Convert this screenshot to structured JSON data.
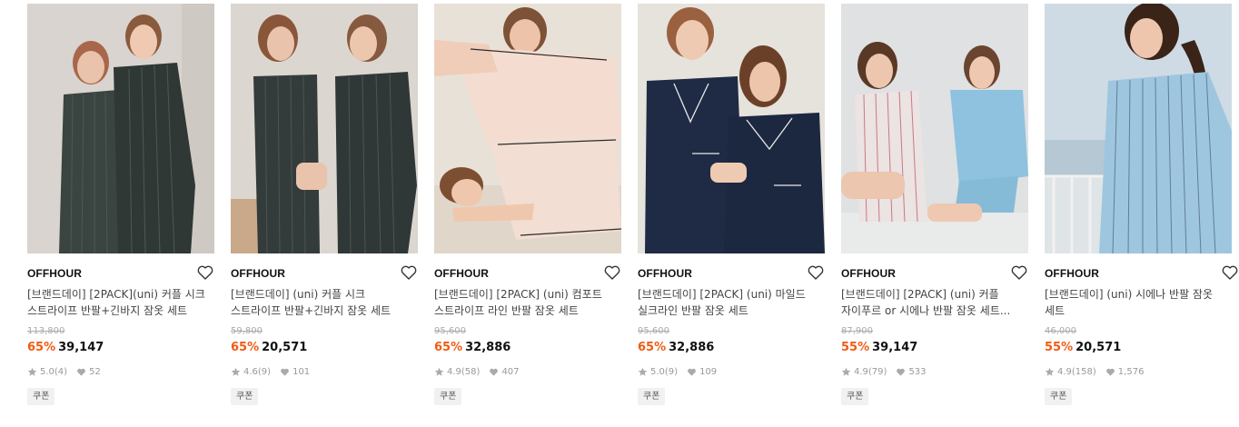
{
  "products": [
    {
      "brand": "OFFHOUR",
      "title": "[브랜드데이] [2PACK](uni) 커플 시크 스트라이프 반팔+긴바지 잠옷 세트",
      "original_price": "113,800",
      "discount": "65%",
      "price": "39,147",
      "rating": "5.0",
      "reviews": "(4)",
      "likes": "52",
      "coupon": "쿠폰"
    },
    {
      "brand": "OFFHOUR",
      "title": "[브랜드데이] (uni) 커플 시크 스트라이프 반팔+긴바지 잠옷 세트",
      "original_price": "59,800",
      "discount": "65%",
      "price": "20,571",
      "rating": "4.6",
      "reviews": "(9)",
      "likes": "101",
      "coupon": "쿠폰"
    },
    {
      "brand": "OFFHOUR",
      "title": "[브랜드데이] [2PACK] (uni) 컴포트 스트라이프 라인 반팔 잠옷 세트",
      "original_price": "95,600",
      "discount": "65%",
      "price": "32,886",
      "rating": "4.9",
      "reviews": "(58)",
      "likes": "407",
      "coupon": "쿠폰"
    },
    {
      "brand": "OFFHOUR",
      "title": "[브랜드데이] [2PACK] (uni) 마일드 실크라인 반팔 잠옷 세트",
      "original_price": "95,600",
      "discount": "65%",
      "price": "32,886",
      "rating": "5.0",
      "reviews": "(9)",
      "likes": "109",
      "coupon": "쿠폰"
    },
    {
      "brand": "OFFHOUR",
      "title": "[브랜드데이] [2PACK] (uni) 커플 자이푸르 or 시에나 반팔 잠옷 세트...",
      "original_price": "87,900",
      "discount": "55%",
      "price": "39,147",
      "rating": "4.9",
      "reviews": "(79)",
      "likes": "533",
      "coupon": "쿠폰"
    },
    {
      "brand": "OFFHOUR",
      "title": "[브랜드데이] (uni) 시에나 반팔 잠옷 세트",
      "original_price": "46,000",
      "discount": "55%",
      "price": "20,571",
      "rating": "4.9",
      "reviews": "(158)",
      "likes": "1,576",
      "coupon": "쿠폰"
    }
  ],
  "colors": {
    "discount": "#f05b14",
    "price": "#111111",
    "muted": "#999999",
    "coupon_bg": "#f1f1f1"
  },
  "icons": {
    "wishlist": "heart-outline-icon",
    "rating": "star-icon",
    "likes": "heart-filled-icon"
  }
}
